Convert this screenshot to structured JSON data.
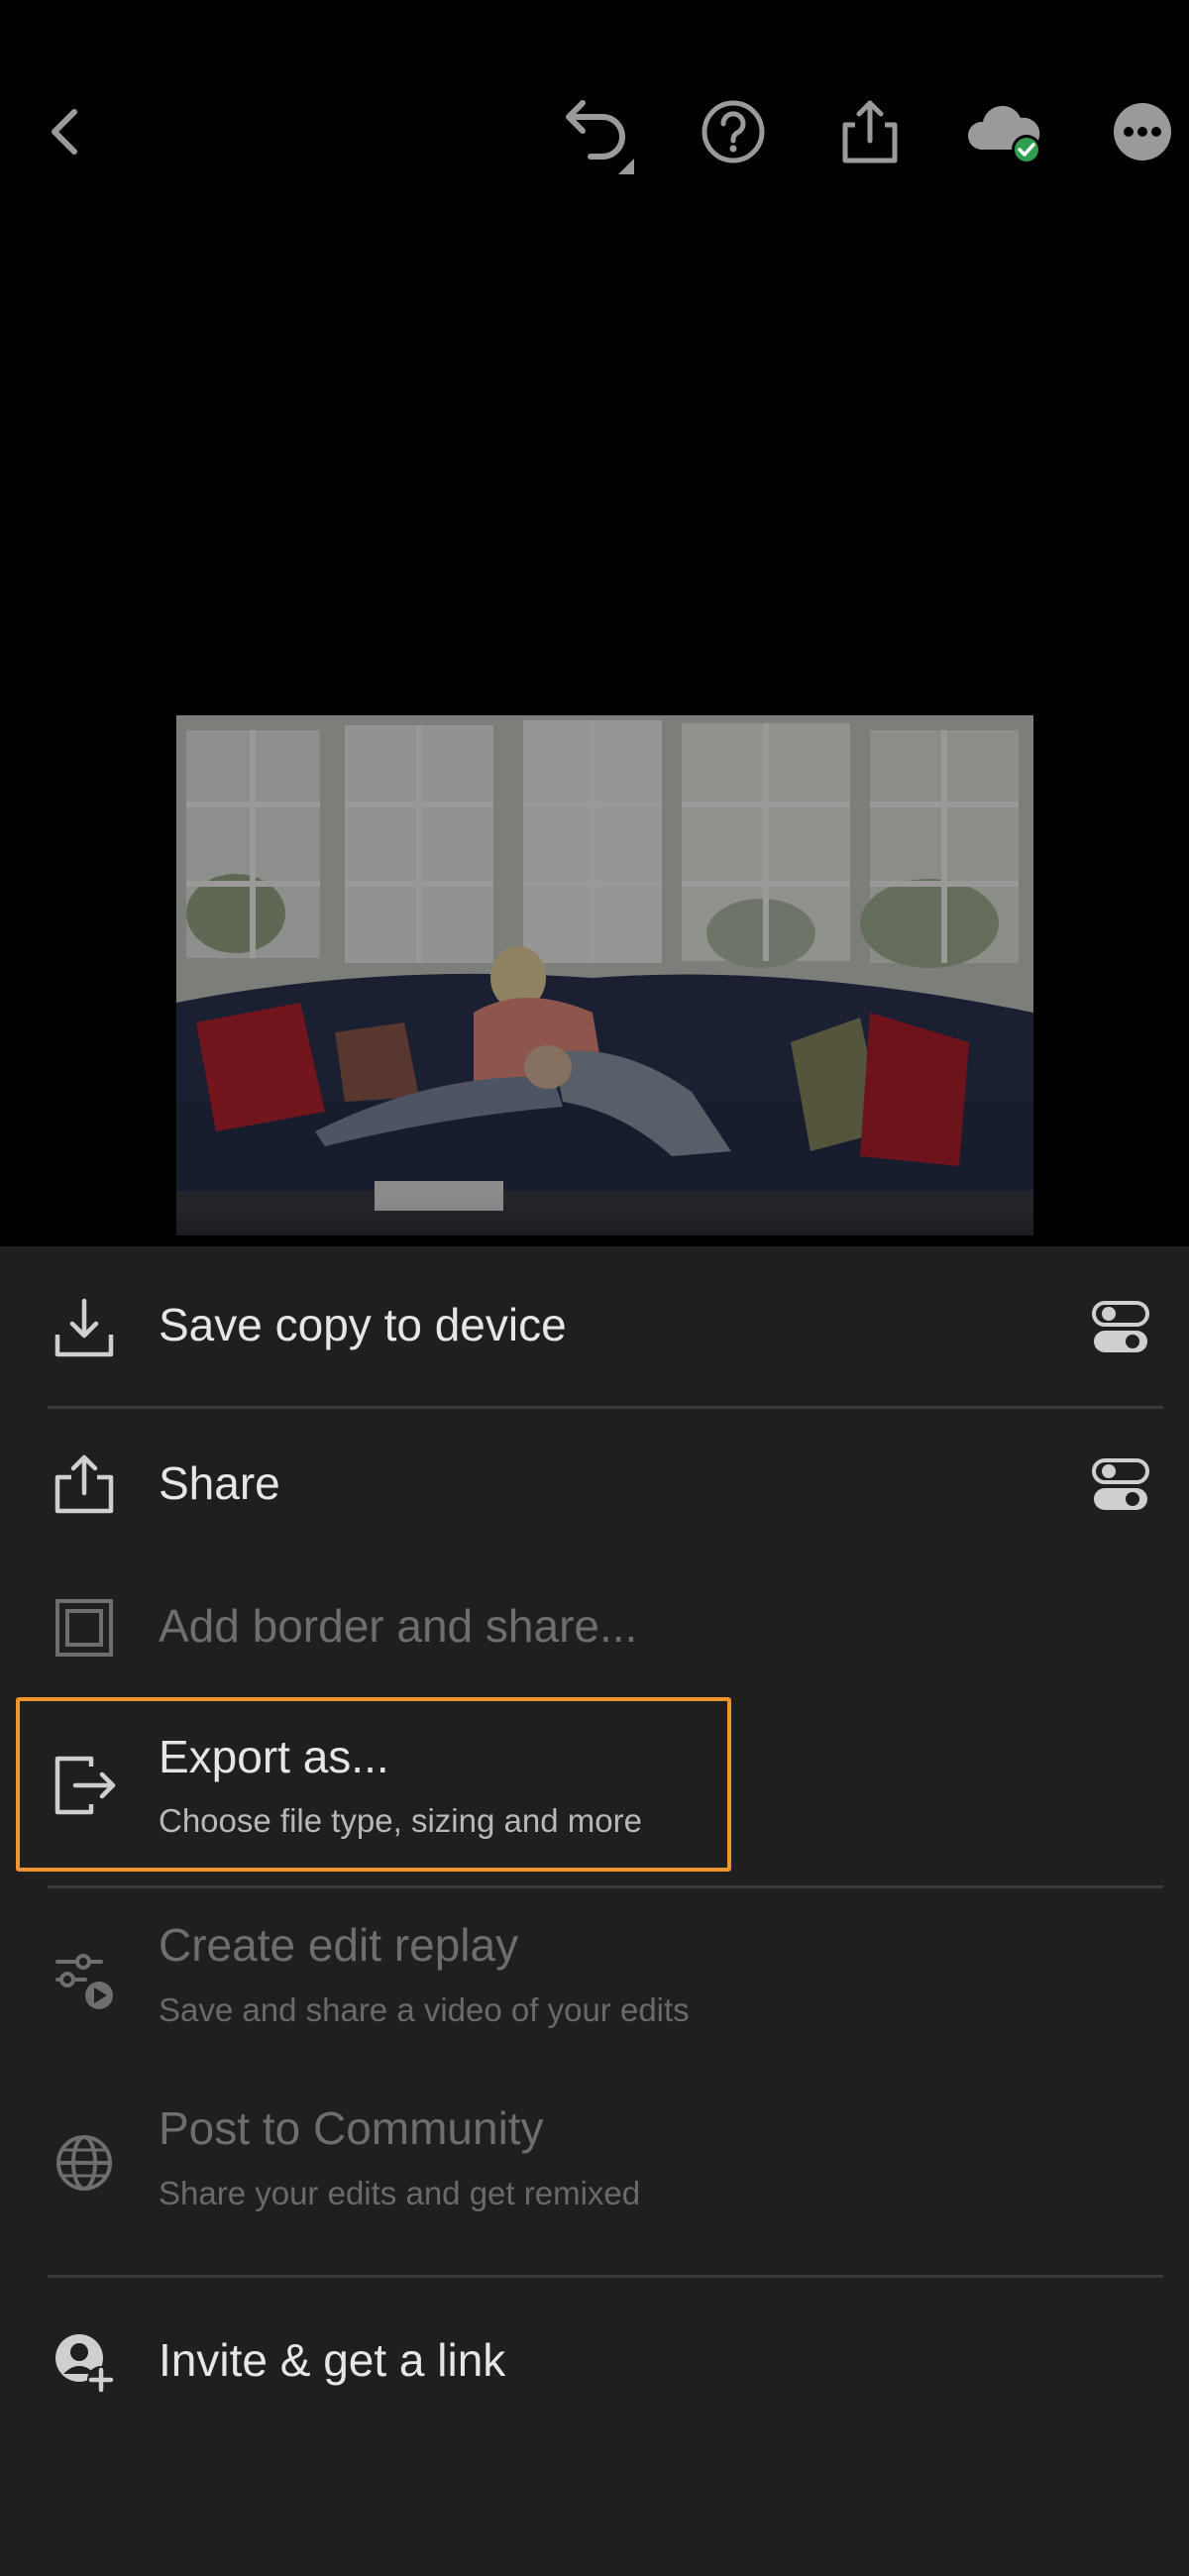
{
  "topbar": {
    "icons": [
      "chevron-left-icon",
      "undo-icon",
      "help-icon",
      "share-icon",
      "cloud-synced-icon",
      "more-icon"
    ],
    "sync_color": "#2e9e4f"
  },
  "menu": {
    "save_copy": {
      "label": "Save copy to device",
      "icon": "download-icon",
      "has_settings": true
    },
    "share": {
      "label": "Share",
      "icon": "share-icon",
      "has_settings": true
    },
    "add_border": {
      "label": "Add border and share...",
      "icon": "border-icon",
      "disabled": true
    },
    "export_as": {
      "label": "Export as...",
      "sublabel": "Choose file type, sizing and more",
      "icon": "export-icon",
      "highlighted": true
    },
    "edit_replay": {
      "label": "Create edit replay",
      "sublabel": "Save and share a video of your edits",
      "icon": "edit-replay-icon",
      "disabled": true
    },
    "community": {
      "label": "Post to Community",
      "sublabel": "Share your edits and get remixed",
      "icon": "globe-icon",
      "disabled": true
    },
    "invite": {
      "label": "Invite & get a link",
      "icon": "invite-person-icon"
    }
  },
  "colors": {
    "highlight": "#f0952e",
    "sheet_bg": "#1f1f1f"
  }
}
